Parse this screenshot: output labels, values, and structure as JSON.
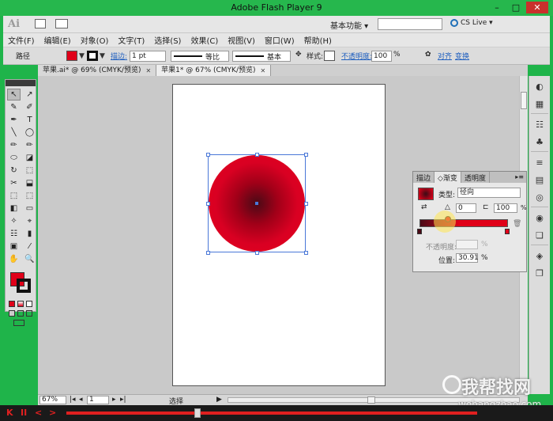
{
  "window": {
    "title": "Adobe Flash Player 9",
    "min": "–",
    "max": "□",
    "close": "✕"
  },
  "appbar": {
    "logo": "Ai",
    "workspace": "基本功能 ▾",
    "search_placeholder": "",
    "cslive": "CS Live ▾"
  },
  "menu": [
    "文件(F)",
    "编辑(E)",
    "对象(O)",
    "文字(T)",
    "选择(S)",
    "效果(C)",
    "视图(V)",
    "窗口(W)",
    "帮助(H)"
  ],
  "control": {
    "object_type": "路径",
    "stroke_link": "描边:",
    "stroke_weight": "1 pt",
    "profile_label": "等比",
    "brush_label": "基本",
    "style_label": "样式:",
    "opacity_link": "不透明度:",
    "opacity_value": "100",
    "opacity_unit": "%",
    "align_link": "对齐",
    "transform_link": "变换",
    "fill_color": "#e00019"
  },
  "tabs": [
    {
      "label": "苹果.ai* @ 69% (CMYK/预览)",
      "close": "✕"
    },
    {
      "label": "苹果1* @ 67% (CMYK/预览)",
      "close": "✕"
    }
  ],
  "toolbox": {
    "tools": [
      "↖",
      "↗",
      "✎",
      "✐",
      "✒",
      "T",
      "╲",
      "◯",
      "✏",
      "✏",
      "⬭",
      "◪",
      "↻",
      "⬚",
      "✂",
      "⬓",
      "⬚",
      "⬚",
      "◧",
      "▭",
      "✧",
      "⌖",
      "☷",
      "▮",
      "▣",
      "⁄",
      "✋",
      "🔍"
    ],
    "fill_color": "#e00019"
  },
  "gradient_panel": {
    "tabs": [
      "描边",
      "◇渐变",
      "透明度"
    ],
    "menu": "▸≡",
    "type_label": "类型:",
    "type_value": "径向",
    "angle_value": "0",
    "aspect_value": "100",
    "aspect_unit": "%",
    "opacity_label": "不透明度:",
    "opacity_unit": "%",
    "position_label": "位置:",
    "position_value": "30.91",
    "position_unit": "%",
    "stops": [
      {
        "color": "#4a0a16",
        "position": 0
      },
      {
        "color": "#e00019",
        "position": 30.91
      },
      {
        "color": "#e00019",
        "position": 100
      }
    ]
  },
  "statusbar": {
    "zoom": "67%",
    "page": "1",
    "tool": "选择"
  },
  "player": {
    "buttons": [
      "K",
      "II",
      "<",
      ">"
    ],
    "progress": 0.32
  },
  "watermark": {
    "big": "我帮找网",
    "small": "wobangzhao.com"
  }
}
